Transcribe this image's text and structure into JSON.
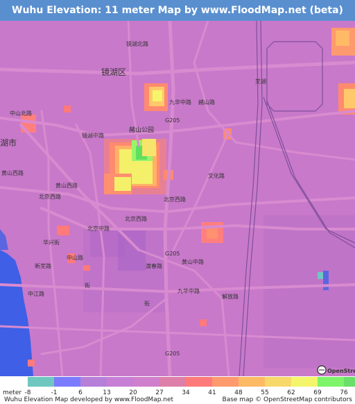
{
  "title": "Wuhu Elevation: 11 meter Map by www.FloodMap.net (beta)",
  "map": {
    "labels": {
      "district": "镜湖区",
      "city": "湖市",
      "park": "赭山公园",
      "road_g205_a": "G205",
      "road_g205_b": "G205",
      "road_g205_c": "G205",
      "zhongshan_n": "中山北路",
      "jinghu_mid": "镜湖中路",
      "jinghu_n": "镜湖北路",
      "jiuhua_mid": "九华中路",
      "zheshan_w": "赭山西路",
      "wenhua": "文化路",
      "zheshan_s": "赭山路",
      "huangshan": "黄山西路",
      "huangshan2": "黄山西路",
      "beijing_w": "北京西路",
      "beijing_w2": "北京西路",
      "beijing_e": "北京西路",
      "beijing_mid": "北京中路",
      "huaxing": "华兴街",
      "xinwu": "新芜路",
      "huangshan_mid": "黄山中路",
      "jiuhua_mid2": "九华中路",
      "zhongshan_n2": "中山路",
      "jiefang": "解放路",
      "zhongjiang": "中江路",
      "jiuhua_mid3": "九华中路",
      "yuchun": "渡春路",
      "jie": "街",
      "jie2": "街",
      "train": "芜湖",
      "osm": "OpenStreetMap"
    }
  },
  "legend": {
    "unit": "meter",
    "ticks": [
      "-8",
      "-1",
      "6",
      "13",
      "20",
      "27",
      "34",
      "41",
      "48",
      "55",
      "62",
      "69",
      "76"
    ],
    "colors": [
      "#6ec8c0",
      "#7b7bff",
      "#b67fd8",
      "#c77fd6",
      "#d07fcc",
      "#dd7fa8",
      "#ff7a7a",
      "#ff9a6e",
      "#ffba66",
      "#f7d86a",
      "#f4f56a",
      "#7ef46a",
      "#6adf6a"
    ]
  },
  "footer": {
    "left": "Wuhu Elevation Map developed by www.FloodMap.net",
    "right": "Base map © OpenStreetMap contributors"
  },
  "colors": {
    "header_bg": "#5a8fcf",
    "map_base": "#c777c9",
    "water": "#3f5fe6",
    "road": "#d98bd0"
  }
}
